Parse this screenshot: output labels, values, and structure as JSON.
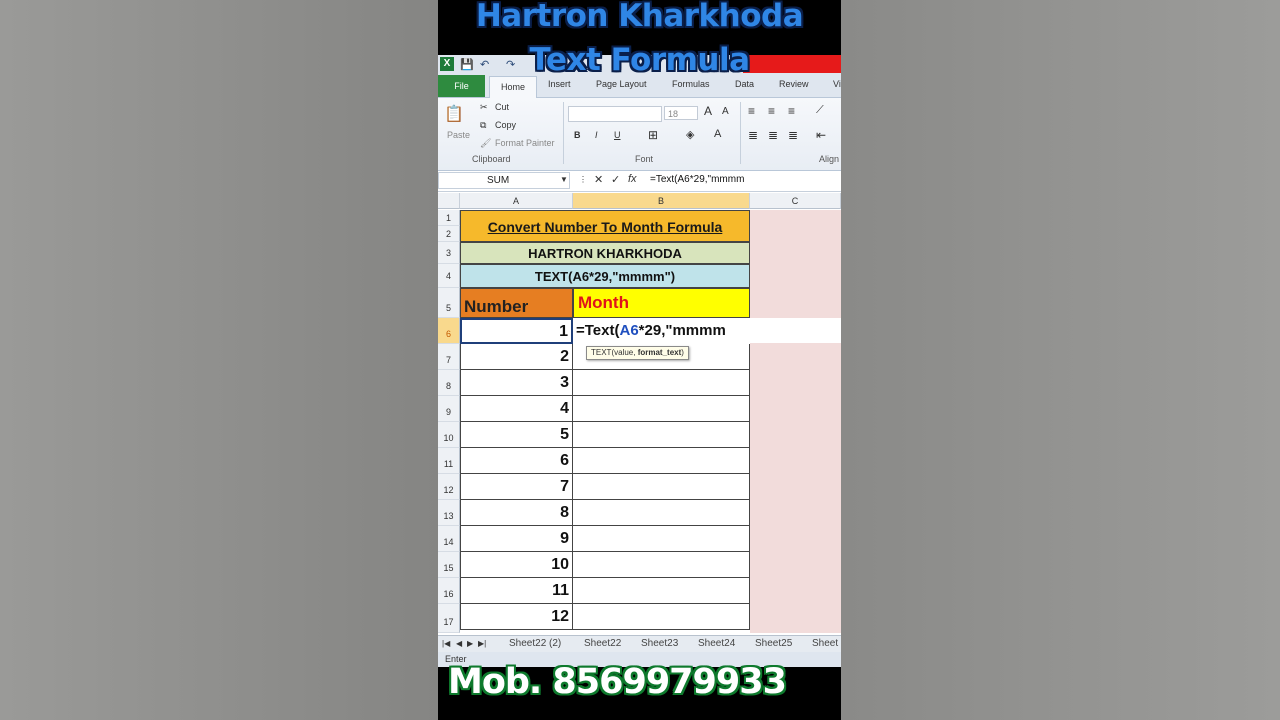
{
  "overlay": {
    "title_line1": "Hartron Kharkhoda",
    "title_line2": "Text Formula",
    "mobile": "Mob. 8569979933"
  },
  "ribbon": {
    "tabs": [
      "File",
      "Home",
      "Insert",
      "Page Layout",
      "Formulas",
      "Data",
      "Review",
      "Vi"
    ],
    "clipboard": {
      "paste": "Paste",
      "cut": "Cut",
      "copy": "Copy",
      "format_painter": "Format Painter",
      "label": "Clipboard"
    },
    "font": {
      "size": "18",
      "bold": "B",
      "italic": "I",
      "underline": "U",
      "label": "Font"
    },
    "alignment_label": "Align"
  },
  "formula_bar": {
    "name_box": "SUM",
    "cancel": "✕",
    "enter": "✓",
    "fx": "fx",
    "content": "=Text(A6*29,\"mmmm"
  },
  "columns": [
    "A",
    "B",
    "C"
  ],
  "rows": [
    "1",
    "2",
    "3",
    "4",
    "5",
    "6",
    "7",
    "8",
    "9",
    "10",
    "11",
    "12",
    "13",
    "14",
    "15",
    "16",
    "17"
  ],
  "sheet": {
    "title": "Convert Number To Month Formula",
    "subtitle": "HARTRON KHARKHODA",
    "formula_caption": "TEXT(A6*29,\"mmmm\")",
    "header_number": "Number",
    "header_month": "Month",
    "numbers": [
      "1",
      "2",
      "3",
      "4",
      "5",
      "6",
      "7",
      "8",
      "9",
      "10",
      "11",
      "12"
    ],
    "edit_prefix": "=Text(",
    "edit_ref": "A6",
    "edit_suffix": "*29,\"mmmm",
    "tooltip_fn": "TEXT(value, ",
    "tooltip_arg": "format_text",
    "tooltip_end": ")"
  },
  "sheet_tabs": [
    "Sheet22 (2)",
    "Sheet22",
    "Sheet23",
    "Sheet24",
    "Sheet25",
    "Sheet"
  ],
  "status": "Enter",
  "colors": {
    "accent_green": "#2e8b3f",
    "title_blue": "#2f86e6",
    "header_orange": "#e67e22",
    "month_red": "#e0141a"
  }
}
